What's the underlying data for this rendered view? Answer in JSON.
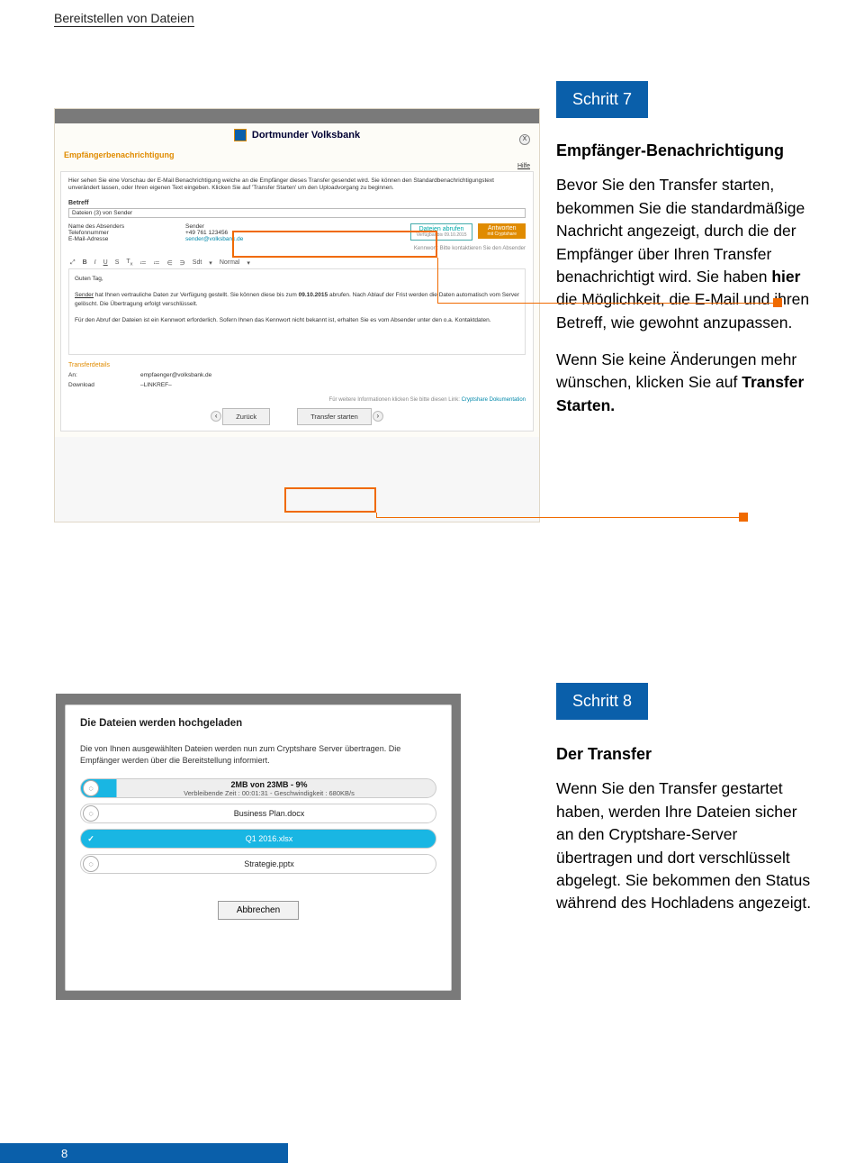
{
  "header": "Bereitstellen von Dateien",
  "footer_page": "8",
  "step7": {
    "badge": "Schritt 7",
    "title": "Empfänger-Benachrichtigung",
    "p1a": "Bevor Sie den Transfer starten, bekommen Sie die standardmäßige Nachricht angezeigt, durch die der Empfänger über Ihren Transfer benachrichtigt wird. Sie haben ",
    "p1b": "hier",
    "p1c": " die Möglichkeit, die E-Mail und ihren Betreff, wie gewohnt anzupassen.",
    "p2a": "Wenn Sie keine Änderungen mehr wünschen, klicken Sie auf ",
    "p2b": "Transfer Starten.",
    "screenshot": {
      "bank": "Dortmunder Volksbank",
      "section_title": "Empfängerbenachrichtigung",
      "hilfe": "Hilfe",
      "intro": "Hier sehen Sie eine Vorschau der E-Mail Benachrichtigung welche an die Empfänger dieses Transfer gesendet wird. Sie können den Standardbenachrichtigungstext unverändert lassen, oder Ihren eigenen Text eingeben. Klicken Sie auf 'Transfer Starten' um den Uploadvorgang zu beginnen.",
      "betreff_label": "Betreff",
      "betreff_value": "Dateien (3) von Sender",
      "col_name_label": "Name des Absenders",
      "col_name_value": "Sender",
      "col_tel_label": "Telefonnummer",
      "col_tel_value": "+49 761 123456",
      "col_mail_label": "E-Mail-Adresse",
      "col_mail_value": "sender@volksbank.de",
      "btn_abrufen": "Dateien abrufen",
      "btn_abrufen_sub": "Verfügbar bis 09.10.2015",
      "btn_antworten": "Antworten",
      "btn_antworten_sub": "mit Cryptshare",
      "kennwort_hint": "Kennwort: Bitte kontaktieren Sie den Absender",
      "toolbar_size": "Sdt",
      "toolbar_style": "Normal",
      "editor_greeting": "Guten Tag,",
      "editor_body1_a": "Sender",
      "editor_body1_b": " hat Ihnen vertrauliche Daten zur Verfügung gestellt. Sie können diese bis zum ",
      "editor_body1_c": "09.10.2015",
      "editor_body1_d": " abrufen. Nach Ablauf der Frist werden die Daten automatisch vom Server gelöscht. Die Übertragung erfolgt verschlüsselt.",
      "editor_body2": "Für den Abruf der Dateien ist ein Kennwort erforderlich. Sofern Ihnen das Kennwort nicht bekannt ist, erhalten Sie es vom Absender unter den o.a. Kontaktdaten.",
      "td_title": "Transferdetails",
      "td_an_label": "An:",
      "td_an_value": "empfaenger@volksbank.de",
      "td_dl_label": "Download",
      "td_dl_value": "–LINKREF–",
      "doclink_pre": "Für weitere Informationen klicken Sie bitte diesen Link: ",
      "doclink": "Cryptshare Dokumentation",
      "btn_back": "Zurück",
      "btn_start": "Transfer starten"
    }
  },
  "step8": {
    "badge": "Schritt 8",
    "title": "Der Transfer",
    "p1": "Wenn Sie den Transfer gestartet haben, werden Ihre Dateien sicher an den Cryptshare-Server übertragen und dort verschlüsselt abgelegt. Sie bekommen den Status während des Hochladens angezeigt.",
    "screenshot": {
      "title": "Die Dateien werden hochgeladen",
      "desc": "Die von Ihnen ausgewählten Dateien werden nun zum Cryptshare Server übertragen. Die Empfänger werden über die Bereitstellung informiert.",
      "progress_main": "2MB von  23MB - 9%",
      "progress_sub": "Verbleibende Zeit : 00:01:31 - Geschwindigkeit : 680KB/s",
      "file1": "Business Plan.docx",
      "file2": "Q1 2016.xlsx",
      "file3": "Strategie.pptx",
      "cancel": "Abbrechen"
    }
  }
}
